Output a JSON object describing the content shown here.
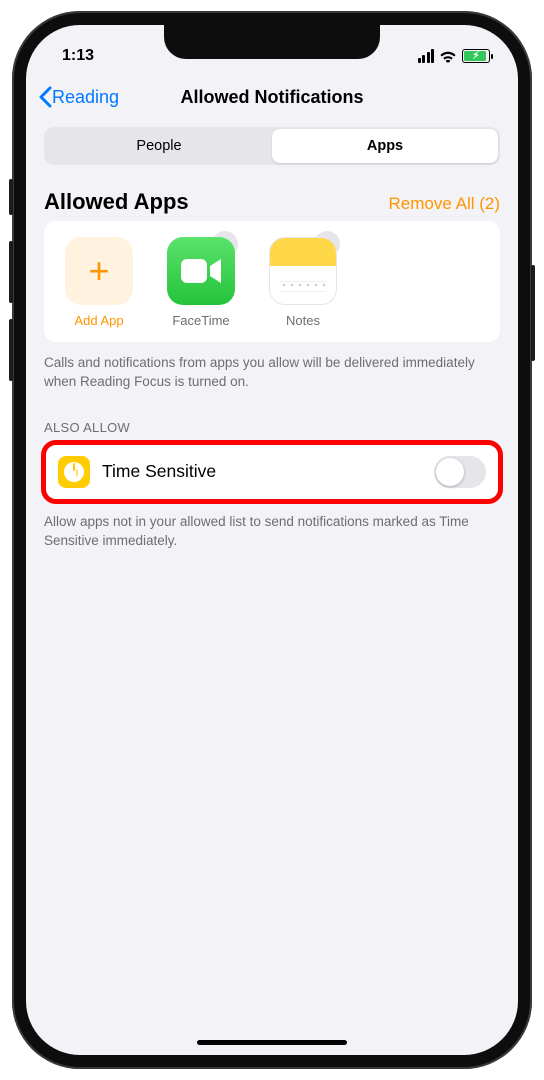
{
  "status": {
    "time": "1:13"
  },
  "nav": {
    "back_label": "Reading",
    "title": "Allowed Notifications"
  },
  "segmented": {
    "items": [
      "People",
      "Apps"
    ],
    "active_index": 1
  },
  "allowed": {
    "title": "Allowed Apps",
    "remove_all_label": "Remove All (2)",
    "add_label": "Add App",
    "apps": [
      {
        "name": "FaceTime",
        "icon": "facetime-icon"
      },
      {
        "name": "Notes",
        "icon": "notes-icon"
      }
    ],
    "description": "Calls and notifications from apps you allow will be delivered immediately when Reading Focus is turned on."
  },
  "also_allow": {
    "group_label": "ALSO ALLOW",
    "row_label": "Time Sensitive",
    "toggle_on": false,
    "description": "Allow apps not in your allowed list to send notifications marked as Time Sensitive immediately."
  }
}
